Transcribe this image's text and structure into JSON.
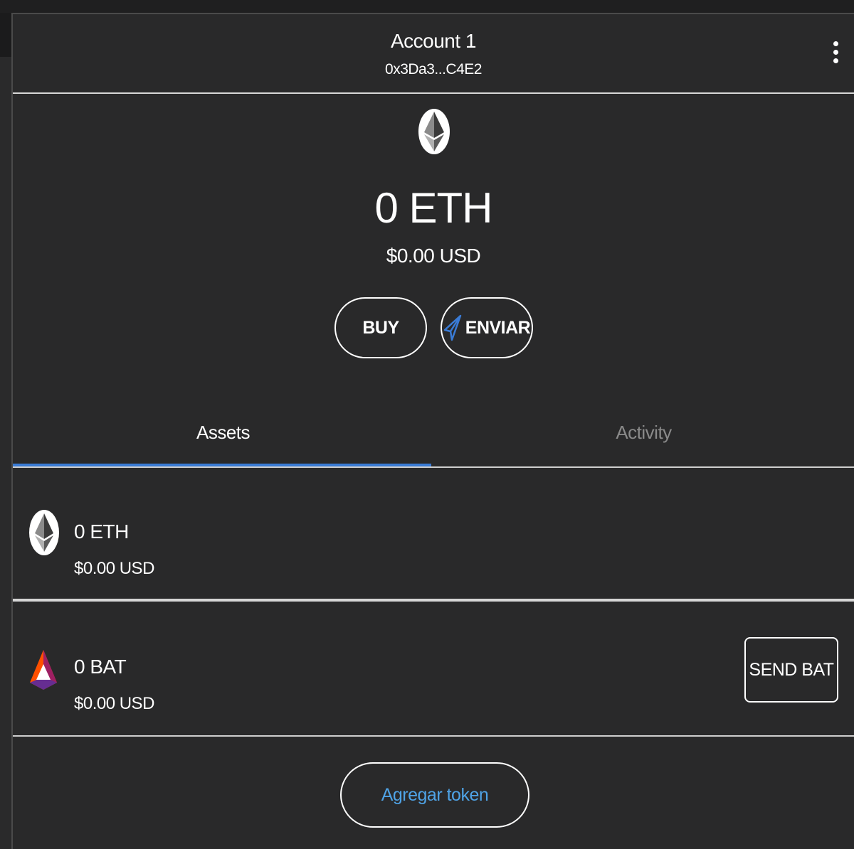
{
  "header": {
    "account_name": "Account 1",
    "account_address": "0x3Da3...C4E2",
    "menu_icon": "kebab-menu-icon"
  },
  "balance": {
    "primary": "0 ETH",
    "secondary": "$0.00 USD",
    "icon": "ethereum-icon"
  },
  "actions": {
    "buy_label": "BUY",
    "send_label": "ENVIAR",
    "send_icon": "paper-plane-icon"
  },
  "tabs": [
    {
      "label": "Assets",
      "active": true
    },
    {
      "label": "Activity",
      "active": false
    }
  ],
  "assets": [
    {
      "amount": "0 ETH",
      "fiat": "$0.00 USD",
      "icon": "ethereum-icon"
    },
    {
      "amount": "0 BAT",
      "fiat": "$0.00 USD",
      "icon": "bat-token-icon",
      "action_label": "SEND BAT"
    }
  ],
  "add_token_label": "Agregar token",
  "colors": {
    "background": "#29292a",
    "accent_blue": "#3a7bd5",
    "link_blue": "#4fa3e6",
    "tab_inactive": "#8a8a8a"
  }
}
